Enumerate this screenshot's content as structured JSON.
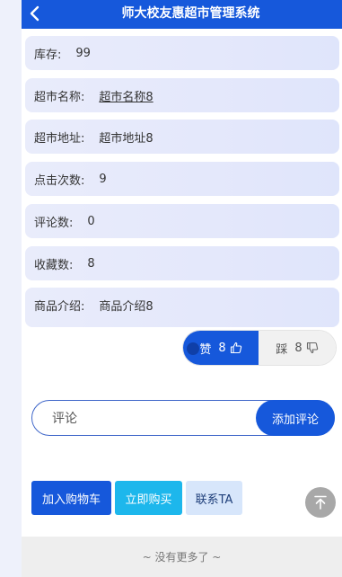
{
  "header": {
    "back_icon": "chevron-left-icon",
    "title": "师大校友惠超市管理系统"
  },
  "details": [
    {
      "label": "库存:",
      "value": "99"
    },
    {
      "label": "超市名称:",
      "value": "超市名称8"
    },
    {
      "label": "超市地址:",
      "value": "超市地址8"
    },
    {
      "label": "点击次数:",
      "value": "9"
    },
    {
      "label": "评论数:",
      "value": "0"
    },
    {
      "label": "收藏数:",
      "value": "8"
    },
    {
      "label": "商品介绍:",
      "value": "商品介绍8"
    }
  ],
  "vote": {
    "like_label": "赞",
    "like_count": "8",
    "dislike_label": "踩",
    "dislike_count": "8"
  },
  "comment": {
    "placeholder": "评论",
    "submit_label": "添加评论"
  },
  "actions": {
    "cart_label": "加入购物车",
    "buy_label": "立即购买",
    "contact_label": "联系TA"
  },
  "footer": {
    "text": "~ 没有更多了 ~"
  },
  "colors": {
    "primary": "#1658db",
    "buy": "#1db7ec",
    "contact_bg": "#d7e6fb"
  }
}
